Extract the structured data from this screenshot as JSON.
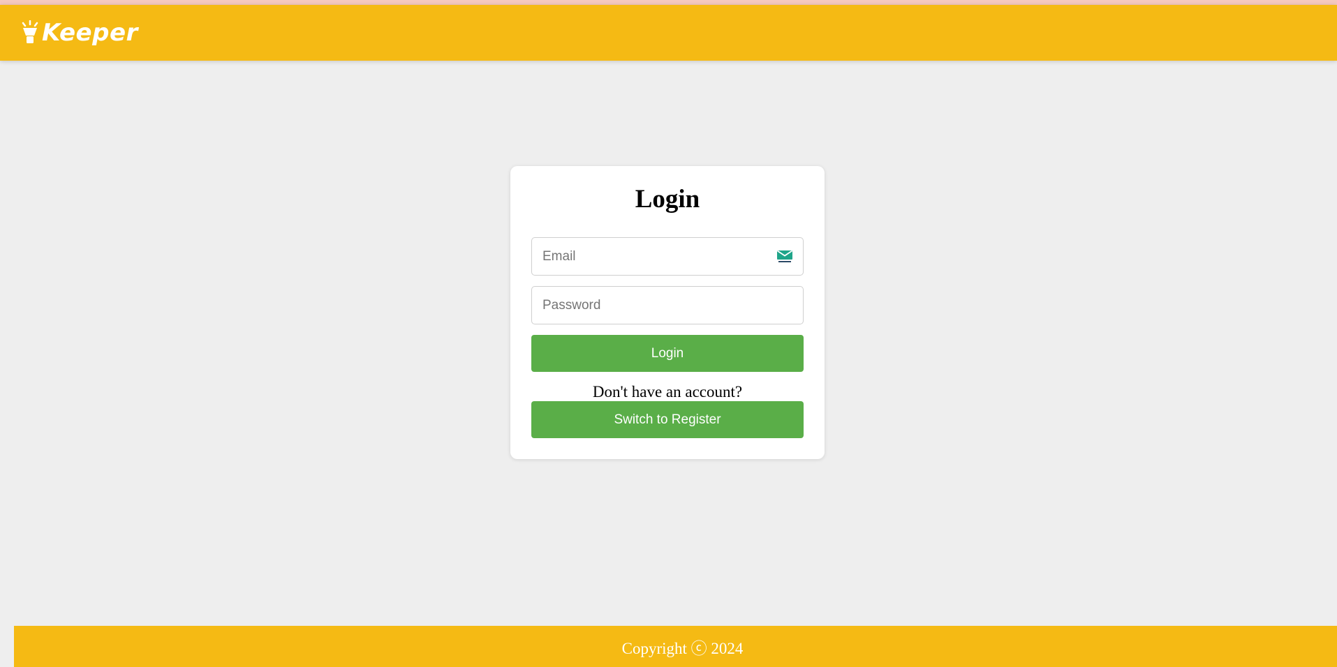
{
  "header": {
    "brand_name": "Keeper",
    "brand_icon": "lightbulb-icon",
    "background_color": "#f5ba14"
  },
  "login_card": {
    "title": "Login",
    "email": {
      "placeholder": "Email",
      "value": "",
      "icon": "mail-icon"
    },
    "password": {
      "placeholder": "Password",
      "value": ""
    },
    "login_button_label": "Login",
    "switch_prompt": "Don't have an account?",
    "register_button_label": "Switch to Register",
    "button_color": "#5aae48"
  },
  "footer": {
    "copyright_text": "Copyright ⓒ 2024"
  }
}
